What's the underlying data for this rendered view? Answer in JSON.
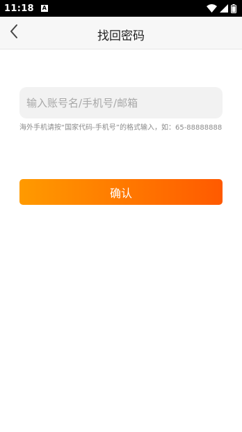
{
  "status_bar": {
    "time": "11:18",
    "notification_badge": "A",
    "icons": [
      "wifi-icon",
      "signal-icon",
      "battery-icon"
    ]
  },
  "header": {
    "title": "找回密码",
    "back_icon": "chevron-left-icon"
  },
  "form": {
    "account_placeholder": "输入账号名/手机号/邮箱",
    "account_value": "",
    "hint": "海外手机请按“国家代码-手机号”的格式输入，如：65-88888888",
    "confirm_label": "确认"
  },
  "colors": {
    "accent_start": "#ff9a00",
    "accent_end": "#ff5a00",
    "input_bg": "#f2f2f2",
    "header_bg": "#f7f7f7"
  }
}
